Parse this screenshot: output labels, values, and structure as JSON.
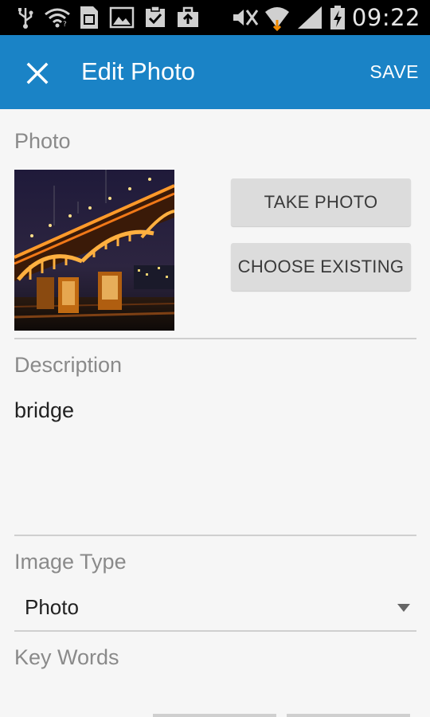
{
  "status_bar": {
    "time": "09:22",
    "icons": [
      "usb-icon",
      "wifi-icon",
      "sim-icon",
      "image-icon",
      "clipboard-check-icon",
      "briefcase-upload-icon",
      "mute-icon",
      "wifi-signal-icon",
      "cell-signal-icon",
      "battery-charging-icon"
    ]
  },
  "app_bar": {
    "title": "Edit Photo",
    "save_label": "SAVE",
    "color": "#1a83c6"
  },
  "photo_section": {
    "label": "Photo",
    "take_photo_label": "TAKE PHOTO",
    "choose_existing_label": "CHOOSE EXISTING"
  },
  "description": {
    "label": "Description",
    "value": "bridge"
  },
  "image_type": {
    "label": "Image Type",
    "selected": "Photo"
  },
  "key_words": {
    "label": "Key Words"
  }
}
